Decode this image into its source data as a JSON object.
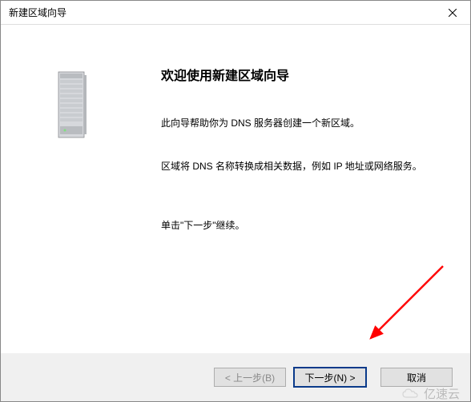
{
  "window": {
    "title": "新建区域向导"
  },
  "main": {
    "heading": "欢迎使用新建区域向导",
    "paragraph1": "此向导帮助你为 DNS 服务器创建一个新区域。",
    "paragraph2": "区域将 DNS 名称转换成相关数据，例如 IP 地址或网络服务。",
    "paragraph3": "单击\"下一步\"继续。"
  },
  "buttons": {
    "back": "< 上一步(B)",
    "next": "下一步(N) >",
    "cancel": "取消"
  },
  "watermark": "亿速云"
}
